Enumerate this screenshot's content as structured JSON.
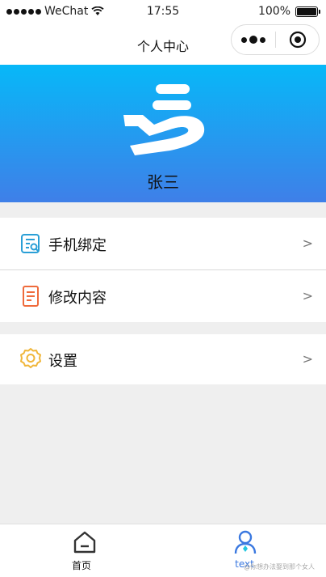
{
  "status_bar": {
    "carrier": "WeChat",
    "time": "17:55",
    "battery": "100%"
  },
  "nav": {
    "title": "个人中心"
  },
  "profile": {
    "name": "张三"
  },
  "menu": {
    "items": [
      {
        "label": "手机绑定",
        "chevron": ">"
      },
      {
        "label": "修改内容",
        "chevron": ">"
      },
      {
        "label": "设置",
        "chevron": ">"
      }
    ]
  },
  "tabbar": {
    "home_label": "首页",
    "profile_label": "text",
    "watermark": "@你想办法娶到那个女人"
  },
  "colors": {
    "header_top": "#07b8f8",
    "header_bottom": "#3f7fe8",
    "phone_icon": "#2a9fd6",
    "edit_icon": "#ef6b3c",
    "settings_icon": "#f0b63a",
    "tab_active": "#3a78e0"
  }
}
